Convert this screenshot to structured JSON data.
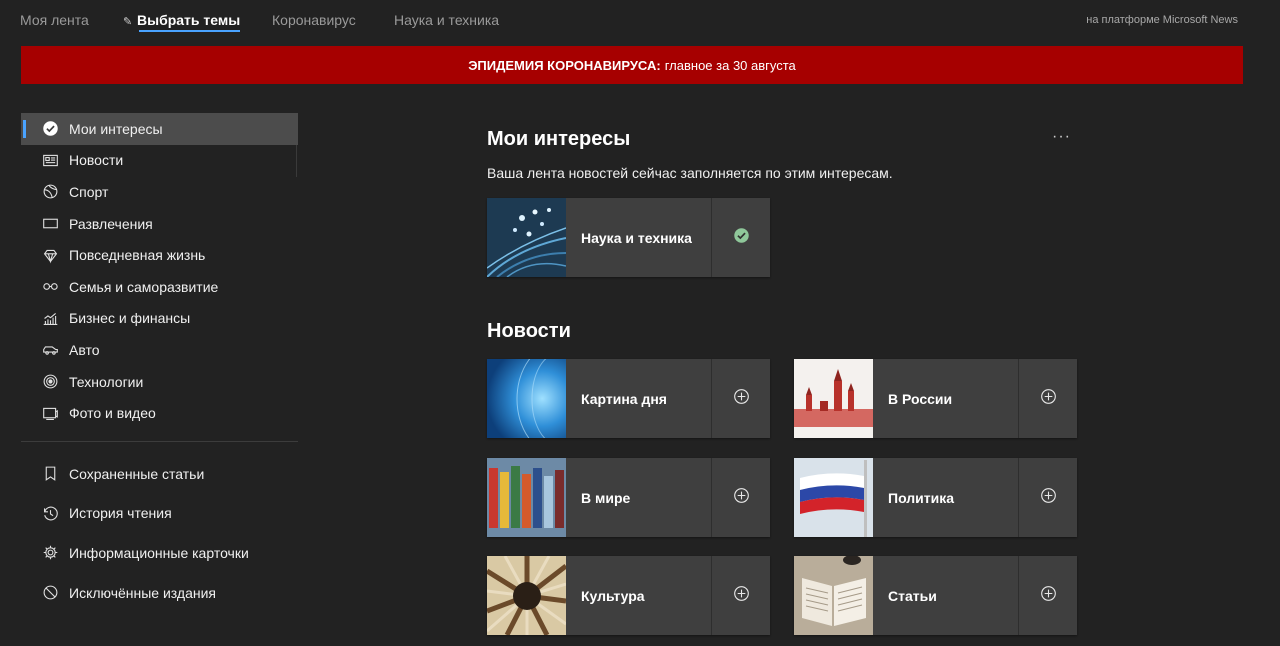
{
  "nav": {
    "tabs": [
      {
        "label": "Моя лента"
      },
      {
        "label": "Выбрать темы"
      },
      {
        "label": "Коронавирус"
      },
      {
        "label": "Наука и техника"
      }
    ],
    "platform": "на платформе Microsoft News"
  },
  "banner": {
    "bold": "ЭПИДЕМИЯ КОРОНАВИРУСА:",
    "text": "главное за 30 августа",
    "color": "#a60000"
  },
  "sidebar": {
    "items": [
      {
        "label": "Мои интересы",
        "icon": "check-circle-icon"
      },
      {
        "label": "Новости",
        "icon": "newspaper-icon"
      },
      {
        "label": "Спорт",
        "icon": "ball-icon"
      },
      {
        "label": "Развлечения",
        "icon": "screen-icon"
      },
      {
        "label": "Повседневная жизнь",
        "icon": "diamond-icon"
      },
      {
        "label": "Семья и саморазвитие",
        "icon": "glasses-icon"
      },
      {
        "label": "Бизнес и финансы",
        "icon": "chart-icon"
      },
      {
        "label": "Авто",
        "icon": "car-icon"
      },
      {
        "label": "Технологии",
        "icon": "tech-icon"
      },
      {
        "label": "Фото и видео",
        "icon": "photo-video-icon"
      }
    ],
    "lower": [
      {
        "label": "Сохраненные статьи",
        "icon": "bookmark-icon"
      },
      {
        "label": "История чтения",
        "icon": "history-icon"
      },
      {
        "label": "Информационные карточки",
        "icon": "gear-icon"
      },
      {
        "label": "Исключённые издания",
        "icon": "block-icon"
      }
    ]
  },
  "main": {
    "interests_title": "Мои интересы",
    "more": "···",
    "interests_subtitle": "Ваша лента новостей сейчас заполняется по этим интересам.",
    "interests": [
      {
        "label": "Наука и техника",
        "state": "selected"
      }
    ],
    "news_title": "Новости",
    "news": [
      {
        "label": "Картина дня",
        "state": "add"
      },
      {
        "label": "В России",
        "state": "add"
      },
      {
        "label": "В мире",
        "state": "add"
      },
      {
        "label": "Политика",
        "state": "add"
      },
      {
        "label": "Культура",
        "state": "add"
      },
      {
        "label": "Статьи",
        "state": "add"
      }
    ]
  },
  "colors": {
    "accent": "#4aa3ff",
    "check": "#8fc79a"
  }
}
